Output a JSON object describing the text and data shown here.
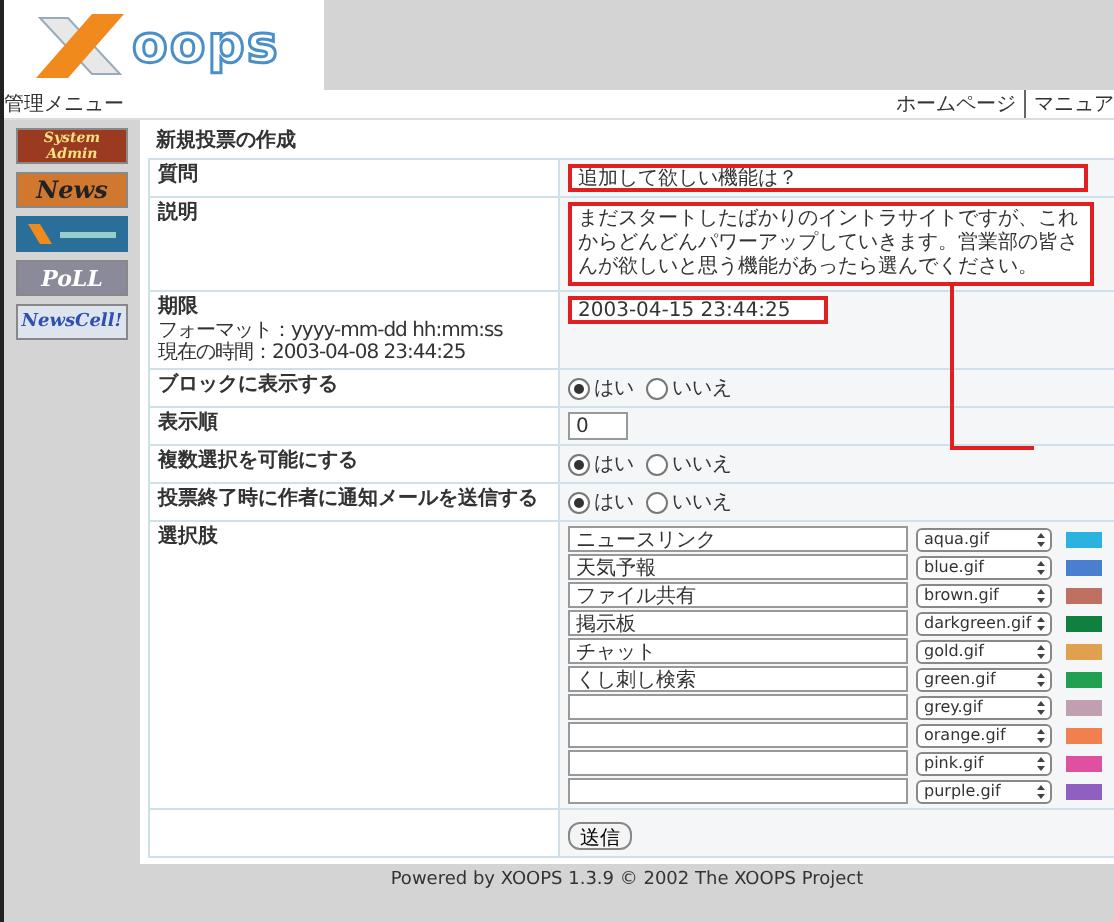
{
  "header": {
    "logo_text": "oops"
  },
  "admin_menu": {
    "title": "管理メニュー",
    "links": [
      "ホームページ",
      "マニュア"
    ]
  },
  "sidebar": {
    "modules": [
      {
        "kind": "admin",
        "label": "System Admin"
      },
      {
        "kind": "news",
        "label": "News"
      },
      {
        "kind": "image"
      },
      {
        "kind": "poll",
        "label": "PoLL"
      },
      {
        "kind": "newscell",
        "label": "NewsCell!"
      }
    ]
  },
  "form": {
    "title": "新規投票の作成",
    "rows": [
      {
        "kind": "text",
        "label": "質問",
        "value": "追加して欲しい機能は？",
        "annotated": true
      },
      {
        "kind": "textarea",
        "label": "説明",
        "value": "まだスタートしたばかりのイントラサイトですが、これからどんどんパワーアップしていきます。営業部の皆さんが欲しいと思う機能があったら選んでください。",
        "annotated": true
      },
      {
        "kind": "date",
        "label": "期限",
        "hints": [
          "フォーマット：yyyy-mm-dd hh:mm:ss",
          "現在の時間：2003-04-08 23:44:25"
        ],
        "value": "2003-04-15 23:44:25",
        "annotated": true
      },
      {
        "kind": "radio",
        "label": "ブロックに表示する",
        "options": [
          {
            "label": "はい",
            "selected": true
          },
          {
            "label": "いいえ",
            "selected": false
          }
        ]
      },
      {
        "kind": "number",
        "label": "表示順",
        "value": "0"
      },
      {
        "kind": "radio",
        "label": "複数選択を可能にする",
        "options": [
          {
            "label": "はい",
            "selected": true
          },
          {
            "label": "いいえ",
            "selected": false
          }
        ]
      },
      {
        "kind": "radio",
        "label": "投票終了時に作者に通知メールを送信する",
        "options": [
          {
            "label": "はい",
            "selected": true
          },
          {
            "label": "いいえ",
            "selected": false
          }
        ]
      },
      {
        "kind": "choices",
        "label": "選択肢",
        "choices": [
          {
            "value": "ニュースリンク",
            "image": "aqua.gif",
            "color": "#2bb3e0"
          },
          {
            "value": "天気予報",
            "image": "blue.gif",
            "color": "#4a7fd0"
          },
          {
            "value": "ファイル共有",
            "image": "brown.gif",
            "color": "#c07060"
          },
          {
            "value": "掲示板",
            "image": "darkgreen.gif",
            "color": "#108040"
          },
          {
            "value": "チャット",
            "image": "gold.gif",
            "color": "#e0a050"
          },
          {
            "value": "くし刺し検索",
            "image": "green.gif",
            "color": "#20a050"
          },
          {
            "image": "grey.gif",
            "color": "#c0a0b0"
          },
          {
            "image": "orange.gif",
            "color": "#f08050"
          },
          {
            "image": "pink.gif",
            "color": "#e050a0"
          },
          {
            "image": "purple.gif",
            "color": "#9060c0"
          }
        ]
      }
    ],
    "submit": "送信"
  },
  "footer": "Powered by XOOPS 1.3.9 © 2002 The XOOPS Project"
}
